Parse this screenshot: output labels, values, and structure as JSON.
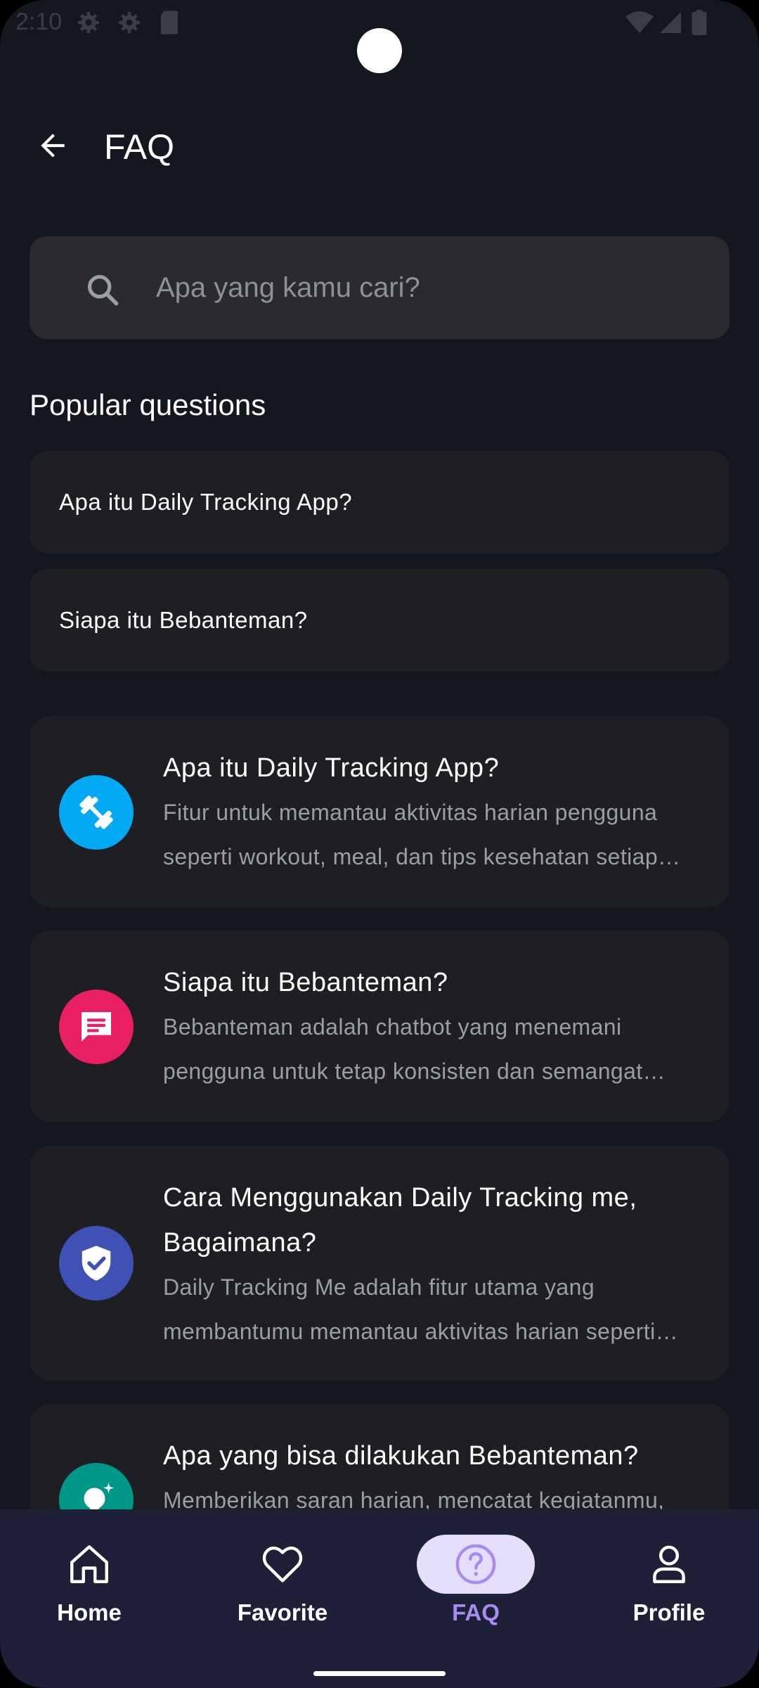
{
  "status_bar": {
    "time": "2:10"
  },
  "header": {
    "title": "FAQ"
  },
  "search": {
    "placeholder": "Apa yang kamu cari?"
  },
  "popular": {
    "title": "Popular questions",
    "items": [
      {
        "label": "Apa itu Daily Tracking App?"
      },
      {
        "label": "Siapa itu Bebanteman?"
      }
    ]
  },
  "faq_cards": [
    {
      "title": "Apa itu Daily Tracking App?",
      "description": "Fitur untuk memantau aktivitas harian pengguna seperti workout, meal, dan tips kesehatan setiap hari.",
      "icon": "dumbbell-icon",
      "color": "#03a9f4"
    },
    {
      "title": "Siapa itu Bebanteman?",
      "description": "Bebanteman adalah chatbot yang menemani pengguna untuk tetap konsisten dan semangat dalam menjalani aktivitas.",
      "icon": "chat-icon",
      "color": "#e91e63"
    },
    {
      "title": "Cara Menggunakan Daily Tracking me, Bagaimana?",
      "description": "Daily Tracking Me adalah fitur utama yang membantumu memantau aktivitas harian seperti workout dan meal.",
      "icon": "shield-check-icon",
      "color": "#3f51b5"
    },
    {
      "title": "Apa yang bisa dilakukan Bebanteman?",
      "description": "Memberikan saran harian, mencatat kegiatanmu,",
      "icon": "lightbulb-icon",
      "color": "#009688"
    }
  ],
  "nav": {
    "items": [
      {
        "label": "Home",
        "icon": "home-icon"
      },
      {
        "label": "Favorite",
        "icon": "heart-icon"
      },
      {
        "label": "FAQ",
        "icon": "help-circle-icon",
        "active": true
      },
      {
        "label": "Profile",
        "icon": "person-icon"
      }
    ],
    "accent": "#a98af0"
  }
}
